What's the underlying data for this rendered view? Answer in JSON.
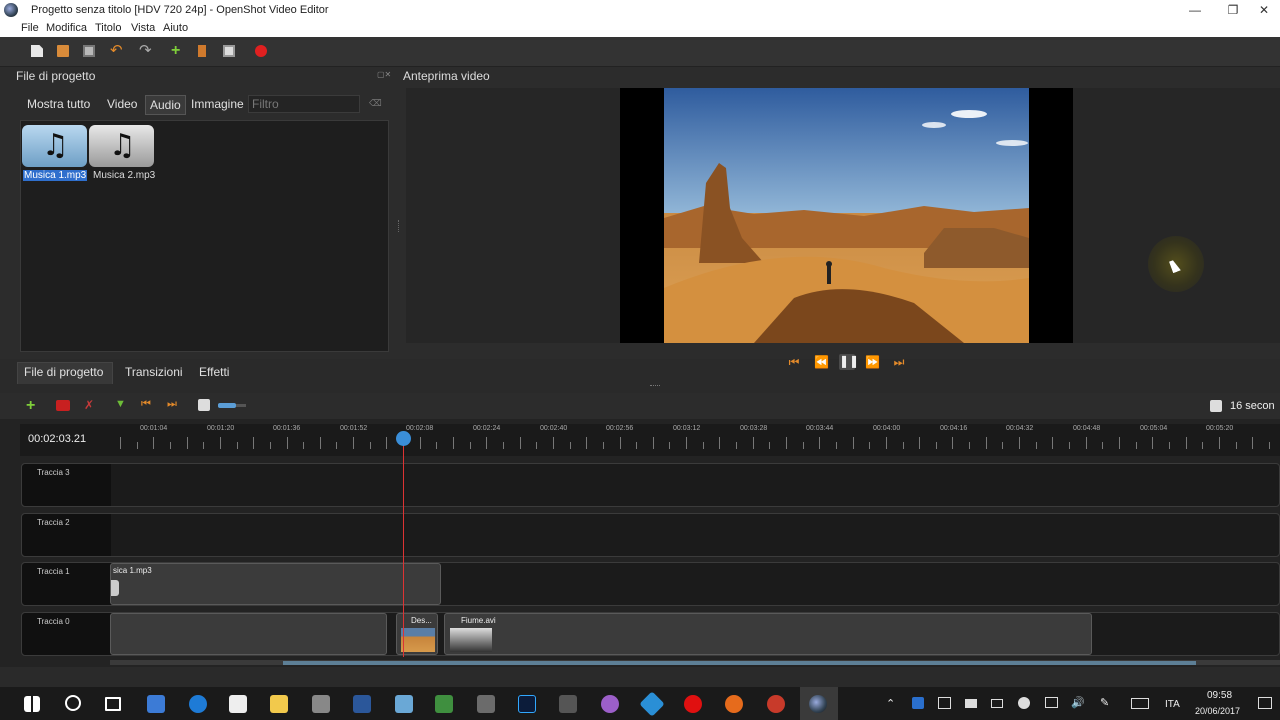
{
  "window": {
    "title": "Progetto senza titolo [HDV 720 24p] - OpenShot Video Editor"
  },
  "menu": [
    "File",
    "Modifica",
    "Titolo",
    "Vista",
    "Aiuto"
  ],
  "left_panel": {
    "title": "File di progetto",
    "filters": [
      "Mostra tutto",
      "Video",
      "Audio",
      "Immagine"
    ],
    "filter_placeholder": "Filtro",
    "files": [
      {
        "name": "Musica 1.mp3",
        "selected": true
      },
      {
        "name": "Musica 2.mp3",
        "selected": false
      }
    ]
  },
  "preview": {
    "title": "Anteprima video"
  },
  "bottom_tabs": [
    "File di progetto",
    "Transizioni",
    "Effetti"
  ],
  "timeline": {
    "current_time": "00:02:03.21",
    "zoom_label": "16 secon",
    "ticks": [
      "00:01:04",
      "00:01:20",
      "00:01:36",
      "00:01:52",
      "00:02:08",
      "00:02:24",
      "00:02:40",
      "00:02:56",
      "00:03:12",
      "00:03:28",
      "00:03:44",
      "00:04:00",
      "00:04:16",
      "00:04:32",
      "00:04:48",
      "00:05:04",
      "00:05:20"
    ],
    "tracks": [
      {
        "name": "Traccia 3",
        "clips": []
      },
      {
        "name": "Traccia 2",
        "clips": []
      },
      {
        "name": "Traccia 1",
        "clips": [
          {
            "label": "sica 1.mp3"
          }
        ]
      },
      {
        "name": "Traccia 0",
        "clips": [
          {
            "label": "Des..."
          },
          {
            "label": "Fiume.avi"
          }
        ]
      }
    ]
  },
  "taskbar": {
    "language": "ITA",
    "time": "09:58",
    "date": "20/06/2017"
  },
  "colors": {
    "accent_orange": "#e38a2a",
    "playhead": "#dd3333",
    "selection": "#2f6fcd"
  }
}
